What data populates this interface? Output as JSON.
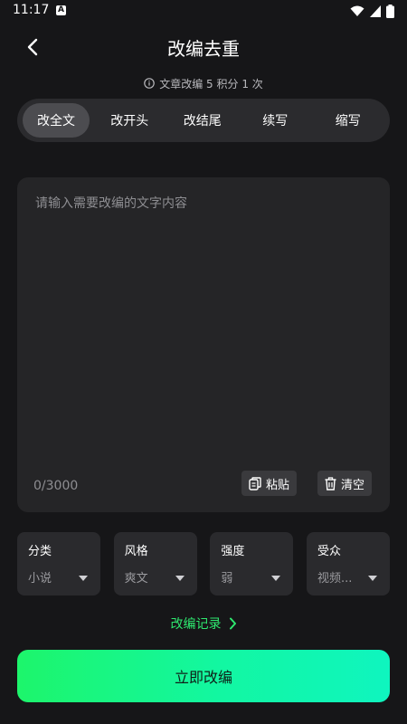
{
  "status_bar": {
    "time": "11:17",
    "icons": [
      "app-a-icon",
      "wifi-icon",
      "signal-icon",
      "battery-icon"
    ]
  },
  "header": {
    "title": "改编去重",
    "back_icon": "chevron-left-icon"
  },
  "points_note": {
    "icon": "info-icon",
    "text": "文章改编 5 积分 1 次"
  },
  "tabs": [
    {
      "label": "改全文",
      "active": true
    },
    {
      "label": "改开头",
      "active": false
    },
    {
      "label": "改结尾",
      "active": false
    },
    {
      "label": "续写",
      "active": false
    },
    {
      "label": "缩写",
      "active": false
    }
  ],
  "editor": {
    "placeholder": "请输入需要改编的文字内容",
    "value": "",
    "char_count": "0/3000",
    "paste_label": "粘贴",
    "clear_label": "清空"
  },
  "options": [
    {
      "label": "分类",
      "value": "小说"
    },
    {
      "label": "风格",
      "value": "爽文"
    },
    {
      "label": "强度",
      "value": "弱"
    },
    {
      "label": "受众",
      "value": "视频..."
    }
  ],
  "history_link": "改编记录",
  "submit_label": "立即改编",
  "colors": {
    "background": "#161618",
    "accent_green": "#2ee86f",
    "button_gradient_start": "#1df56b",
    "button_gradient_end": "#0ff5bf"
  }
}
